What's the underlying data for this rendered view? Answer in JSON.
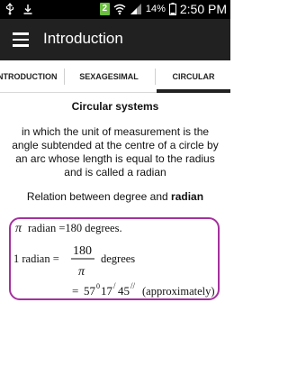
{
  "status_bar": {
    "sim_label": "2",
    "battery_percent": "14%",
    "time": "2:50 PM",
    "icons": [
      "usb-icon",
      "download-icon",
      "wifi-icon",
      "signal-icon",
      "battery-icon"
    ]
  },
  "app_bar": {
    "title": "Introduction",
    "menu_icon": "hamburger-menu-icon"
  },
  "tabs": [
    {
      "label": "INTRODUCTION",
      "selected": false
    },
    {
      "label": "SEXAGESIMAL",
      "selected": false
    },
    {
      "label": "CIRCULAR",
      "selected": true
    }
  ],
  "content": {
    "section_title": "Circular systems",
    "definition": "in which the unit of measurement is the angle subtended at the centre of a circle by an arc whose length is equal to the radius and is called a radian",
    "relation_prefix": "Relation between degree and ",
    "relation_emphasis": "radian"
  },
  "formula": {
    "line1_symbol": "π",
    "line1_text": "radian =180 degrees.",
    "line2_label": "1 radian =",
    "line2_numerator": "180",
    "line2_denominator": "π",
    "line2_unit": "degrees",
    "line3_equals": "=",
    "line3_deg": "57",
    "line3_deg_sup": "0",
    "line3_min": "17",
    "line3_min_sup": "/",
    "line3_sec": "45",
    "line3_sec_sup": "//",
    "line3_note": "(approximately)"
  },
  "colors": {
    "app_bar": "#212121",
    "formula_border": "#a4319e",
    "sim_badge": "#6bbf3f"
  }
}
